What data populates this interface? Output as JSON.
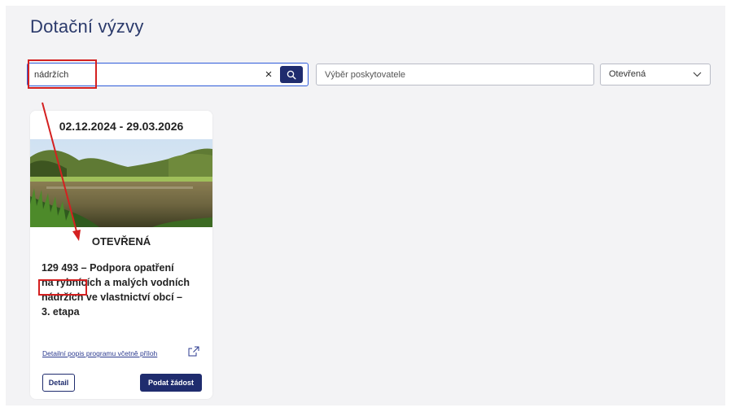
{
  "page": {
    "title": "Dotační výzvy"
  },
  "filters": {
    "search": {
      "value": "nádržích",
      "clear_glyph": "×",
      "search_icon": "search-icon"
    },
    "provider": {
      "placeholder": "Výběr poskytovatele"
    },
    "status": {
      "selected": "Otevřená"
    }
  },
  "card": {
    "dates": "02.12.2024 - 29.03.2026",
    "status": "OTEVŘENÁ",
    "title_lines": [
      "129 493 – Podpora opatření",
      "na rybnících a malých vodních",
      "nádržích ve vlastnictví obcí –",
      "3. etapa"
    ],
    "detail_link": "Detailní popis programu včetně příloh",
    "detail_button": "Detail",
    "submit_button": "Podat žádost"
  },
  "annotations": {
    "highlight_color": "#d42020"
  },
  "colors": {
    "accent": "#1f2c6e",
    "title": "#2b3a6b",
    "background": "#f3f3f5"
  }
}
